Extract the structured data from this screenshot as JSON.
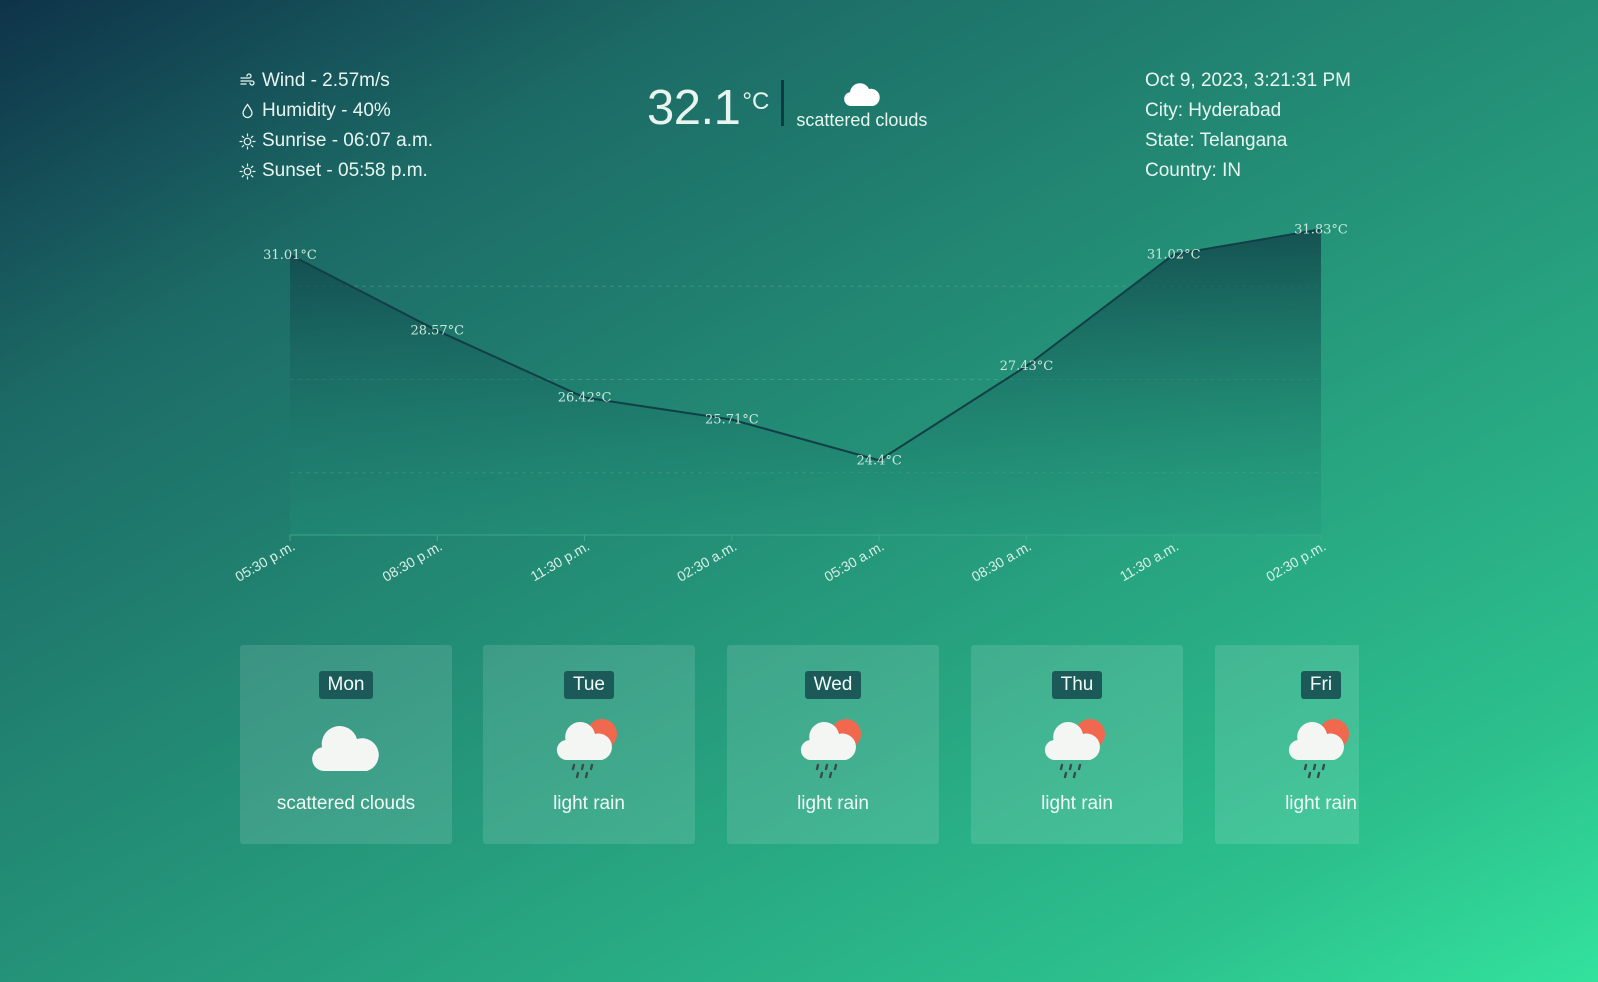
{
  "stats": {
    "wind": "Wind - 2.57m/s",
    "humidity": "Humidity - 40%",
    "sunrise": "Sunrise - 06:07 a.m.",
    "sunset": "Sunset - 05:58 p.m."
  },
  "current": {
    "temp": "32.1",
    "unit": "°C",
    "condition": "scattered clouds",
    "icon": "cloud-icon"
  },
  "location": {
    "datetime": "Oct 9, 2023, 3:21:31 PM",
    "city": "City: Hyderabad",
    "state": "State: Telangana",
    "country": "Country: IN"
  },
  "colors": {
    "line": "#123f47",
    "area_top": "#0f3c45",
    "area_bottom": "#21937a",
    "day_badge": "#1c5a5a",
    "sun": "#f0694f"
  },
  "chart_data": {
    "type": "area",
    "categories": [
      "05:30 p.m.",
      "08:30 p.m.",
      "11:30 p.m.",
      "02:30 a.m.",
      "05:30 a.m.",
      "08:30 a.m.",
      "11:30 a.m.",
      "02:30 p.m."
    ],
    "values": [
      31.01,
      28.57,
      26.42,
      25.71,
      24.4,
      27.43,
      31.02,
      31.83
    ],
    "data_labels": [
      "31.01°C",
      "28.57°C",
      "26.42°C",
      "25.71°C",
      "24.4°C",
      "27.43°C",
      "31.02°C",
      "31.83°C"
    ],
    "ylim": [
      22,
      32.9
    ],
    "grid": true,
    "title": "",
    "xlabel": "",
    "ylabel": ""
  },
  "forecast": [
    {
      "day": "Mon",
      "desc": "scattered clouds",
      "icon": "cloud-icon"
    },
    {
      "day": "Tue",
      "desc": "light rain",
      "icon": "rain-sun-icon"
    },
    {
      "day": "Wed",
      "desc": "light rain",
      "icon": "rain-sun-icon"
    },
    {
      "day": "Thu",
      "desc": "light rain",
      "icon": "rain-sun-icon"
    },
    {
      "day": "Fri",
      "desc": "light rain",
      "icon": "rain-sun-icon"
    }
  ]
}
